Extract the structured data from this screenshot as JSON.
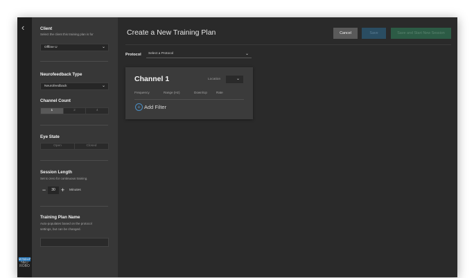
{
  "sidebar": {
    "client": {
      "heading": "Client",
      "hint": "Select the client this training plan is for",
      "selected": "Offline U"
    },
    "neurofeedback": {
      "heading": "Neurofeedback Type",
      "selected": "Neurofeedback"
    },
    "channel_count": {
      "heading": "Channel Count",
      "options": [
        "1",
        "2",
        "4"
      ],
      "selected": "1"
    },
    "eye_state": {
      "heading": "Eye State",
      "options": [
        "Open",
        "Closed"
      ]
    },
    "session_length": {
      "heading": "Session Length",
      "hint": "Set to zero for continuous training.",
      "decrement": "−",
      "value": "30",
      "increment": "+",
      "unit": "Minutes"
    },
    "plan_name": {
      "heading": "Training Plan Name",
      "hint_line1": "Auto-populates based on the protocol",
      "hint_line2": "settings, but can be changed.",
      "value": ""
    }
  },
  "nav": {
    "back": "‹"
  },
  "logo": {
    "line1": "MYNDLIF",
    "line2": "NEU",
    "line3": "ROBO"
  },
  "header": {
    "title": "Create a New Training Plan",
    "cancel": "Cancel",
    "save": "Save",
    "save_start": "Save and Start New Session"
  },
  "protocol": {
    "label": "Protocol",
    "placeholder": "Select a Protocol"
  },
  "channel_card": {
    "title": "Channel 1",
    "location_label": "Location",
    "columns": [
      "Frequency",
      "Range (Hz)",
      "Down/Up",
      "Rate"
    ],
    "add_filter": "Add Filter"
  },
  "icons": {
    "back": "chevron-left-icon",
    "dropdown": "chevron-down-icon",
    "add": "plus-circle-icon"
  },
  "colors": {
    "accent_blue": "#2b78b8",
    "save_disabled": "#2a4d62",
    "save_start_disabled": "#2c5b45"
  }
}
